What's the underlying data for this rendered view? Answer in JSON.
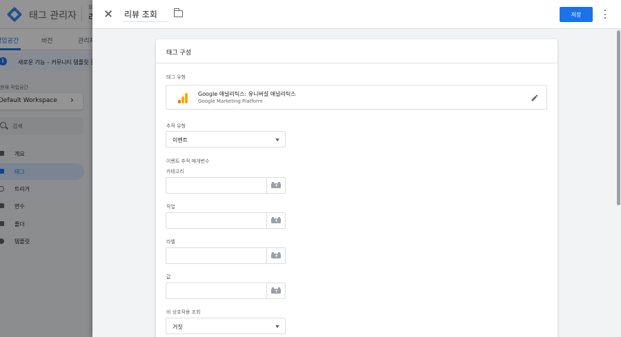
{
  "background_app": {
    "title": "태그 관리자",
    "account_small": "모",
    "account": "리",
    "tabs": [
      {
        "label": "작업공간"
      },
      {
        "label": "버전"
      },
      {
        "label": "관리자"
      }
    ],
    "banner_icon": "info-icon",
    "banner_text": "새로운 기능 – 커뮤니티 템플릿 갤",
    "workspace_label": "현재 작업공간",
    "workspace_name": "Default Workspace",
    "search_placeholder": "검색",
    "nav": [
      {
        "label": "개요",
        "icon": "overview-icon"
      },
      {
        "label": "태그",
        "icon": "tag-icon",
        "active": true
      },
      {
        "label": "트리거",
        "icon": "trigger-icon"
      },
      {
        "label": "변수",
        "icon": "variable-icon"
      },
      {
        "label": "폴더",
        "icon": "folder-icon"
      },
      {
        "label": "템플릿",
        "icon": "template-icon"
      }
    ]
  },
  "sheet": {
    "tag_name": "리뷰 조회",
    "save_label": "저장",
    "accent_color": "#1a73e8"
  },
  "card": {
    "title": "태그 구성",
    "tag_type_label": "태그 유형",
    "tag_type_name": "Google 애널리틱스: 유니버설 애널리틱스",
    "tag_type_sub": "Google Marketing Platform",
    "track_type_label": "추적 유형",
    "track_type_value": "이벤트",
    "event_params_label": "이벤트 추적 매개변수",
    "fields": [
      {
        "label": "카테고리",
        "value": ""
      },
      {
        "label": "작업",
        "value": ""
      },
      {
        "label": "라벨",
        "value": ""
      },
      {
        "label": "값",
        "value": ""
      }
    ],
    "non_interaction_label": "비 상호작용 조회",
    "non_interaction_value": "거짓"
  }
}
